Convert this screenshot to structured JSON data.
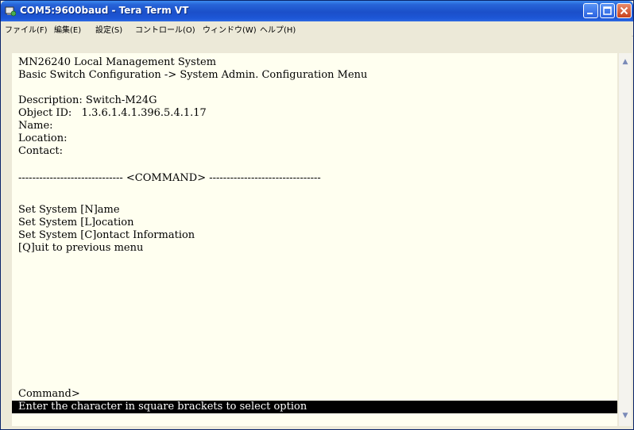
{
  "window": {
    "title": "COM5:9600baud - Tera Term VT"
  },
  "menu": [
    {
      "label": "ファイル(F)"
    },
    {
      "label": "編集(E)"
    },
    {
      "label": "設定(S)"
    },
    {
      "label": "コントロール(O)"
    },
    {
      "label": "ウィンドウ(W)"
    },
    {
      "label": "ヘルプ(H)"
    }
  ],
  "terminal": {
    "lines": [
      "MN26240 Local Management System",
      "Basic Switch Configuration -> System Admin. Configuration Menu",
      "",
      "Description: Switch-M24G",
      "Object ID:   1.3.6.1.4.1.396.5.4.1.17",
      "Name:",
      "Location:",
      "Contact:",
      "",
      "------------------------------ <COMMAND> --------------------------------",
      "",
      "Set System [N]ame",
      "Set System [L]ocation",
      "Set System [C]ontact Information",
      "[Q]uit to previous menu"
    ],
    "prompt": "Command>",
    "status": "Enter the character in square brackets to select option"
  },
  "colors": {
    "terminal_bg": "#fffff0",
    "terminal_fg": "#000000",
    "titlebar": "#2764d8",
    "status_bg": "#000000",
    "status_fg": "#ffffff"
  }
}
